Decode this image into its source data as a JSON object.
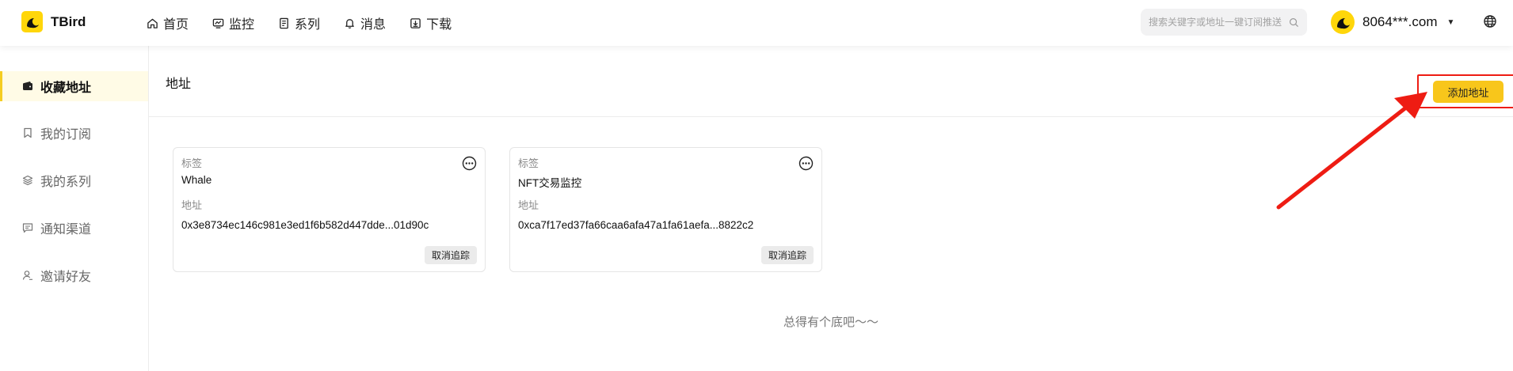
{
  "app": {
    "brand": "TBird"
  },
  "nav": [
    {
      "label": "首页",
      "icon": "home-icon"
    },
    {
      "label": "监控",
      "icon": "monitor-icon"
    },
    {
      "label": "系列",
      "icon": "collection-icon"
    },
    {
      "label": "消息",
      "icon": "bell-icon"
    },
    {
      "label": "下载",
      "icon": "download-icon"
    }
  ],
  "search": {
    "placeholder": "搜索关键字或地址一键订阅推送",
    "icon": "search-icon"
  },
  "user": {
    "name": "8064***.com",
    "avatar": "moon-avatar-icon"
  },
  "sidebar": {
    "items": [
      {
        "label": "收藏地址",
        "icon": "wallet-icon",
        "active": true
      },
      {
        "label": "我的订阅",
        "icon": "bookmark-icon",
        "active": false
      },
      {
        "label": "我的系列",
        "icon": "layers-icon",
        "active": false
      },
      {
        "label": "通知渠道",
        "icon": "message-icon",
        "active": false
      },
      {
        "label": "邀请好友",
        "icon": "user-icon",
        "active": false
      }
    ]
  },
  "main": {
    "title": "地址",
    "add_button": "添加地址",
    "cards": [
      {
        "tag_label": "标签",
        "tag": "Whale",
        "address_label": "地址",
        "address": "0x3e8734ec146c981e3ed1f6b582d447dde...01d90c",
        "untrack_label": "取消追踪"
      },
      {
        "tag_label": "标签",
        "tag": "NFT交易监控",
        "address_label": "地址",
        "address": "0xca7f17ed37fa66caa6afa47a1fa61aefa...8822c2",
        "untrack_label": "取消追踪"
      }
    ],
    "end_note": "总得有个底吧～～"
  },
  "colors": {
    "accent": "#f8c61b",
    "annotation": "#ee1c13"
  }
}
